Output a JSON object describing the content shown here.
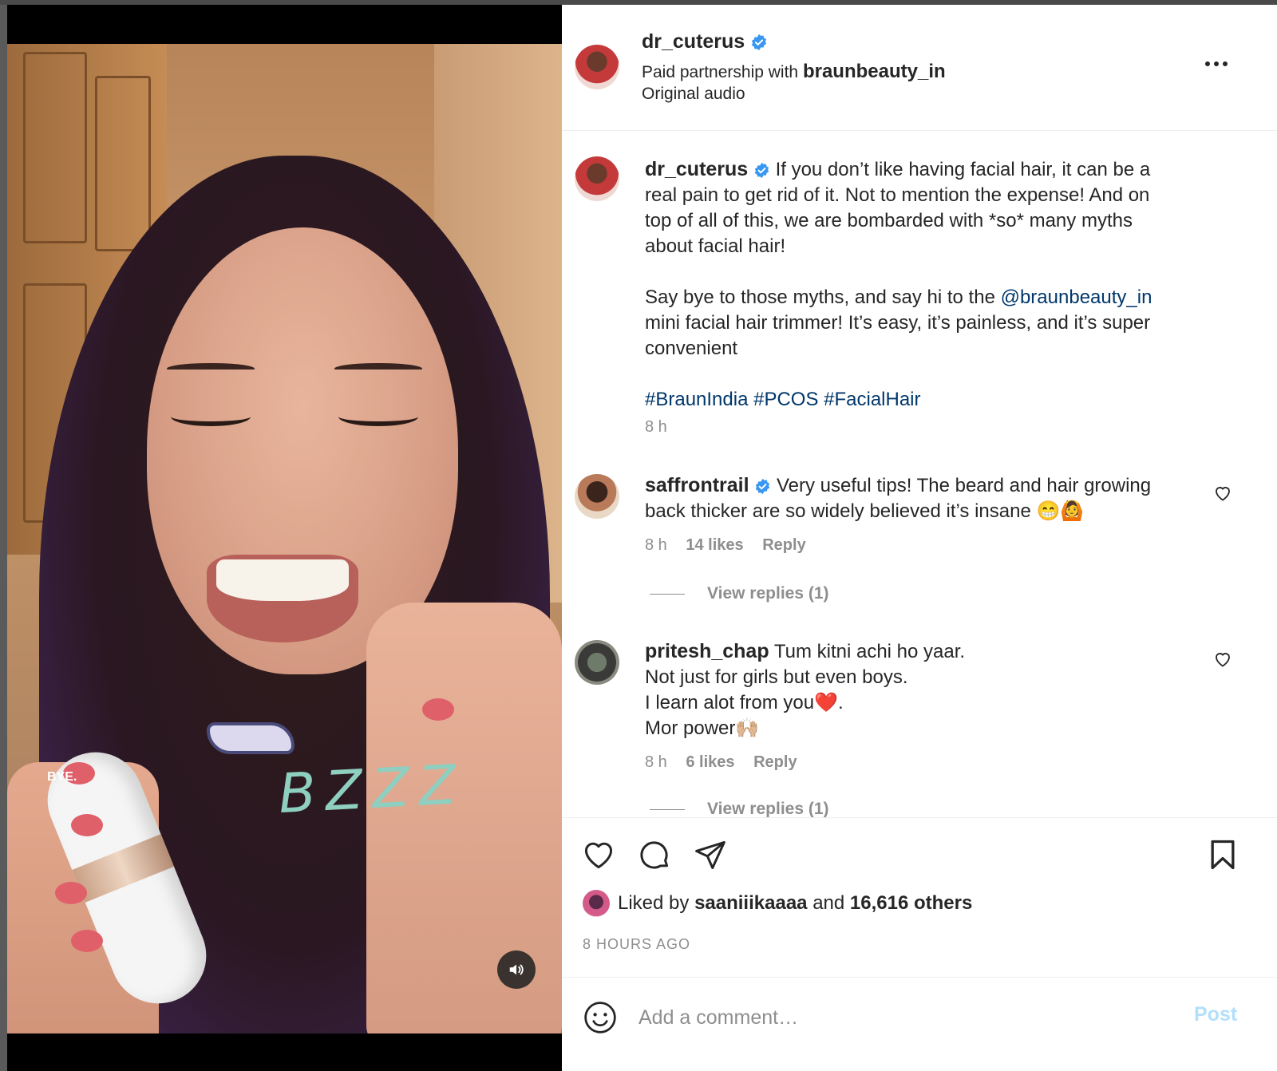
{
  "media": {
    "sticker_text": "BZZZ",
    "overlay_text": "BYE."
  },
  "header": {
    "username": "dr_cuterus",
    "partnership_prefix": "Paid partnership with",
    "partner": "braunbeauty_in",
    "audio": "Original audio"
  },
  "caption": {
    "username": "dr_cuterus",
    "line1": "If you don’t like having facial hair, it can be a",
    "line2": "real pain to get rid of it. Not to mention the expense! And on",
    "line3": "top of all of this, we are bombarded with *so* many myths",
    "line4": "about facial hair!",
    "p2_line1_prefix": "Say bye to those myths, and say hi to the",
    "p2_mention": "@braunbeauty_in",
    "p2_line2": "mini facial hair trimmer! It’s easy, it’s painless, and it’s super",
    "p2_line3": "convenient",
    "hashtags": "#BraunIndia #PCOS #FacialHair",
    "time": "8 h"
  },
  "comments": [
    {
      "username": "saffrontrail",
      "line1": "Very useful tips! The beard and hair growing",
      "line2": "back thicker are so widely believed it’s insane 😁🙆",
      "time": "8 h",
      "likes": "14 likes",
      "reply": "Reply",
      "view_replies": "View replies (1)"
    },
    {
      "username": "pritesh_chap",
      "line1": "Tum kitni achi ho yaar.",
      "line2": "Not just for girls but even boys.",
      "line3": "I learn alot from you❤️.",
      "line4": "Mor power🙌🏼",
      "time": "8 h",
      "likes": "6 likes",
      "reply": "Reply",
      "view_replies": "View replies (1)"
    }
  ],
  "actions": {
    "liked_by_prefix": "Liked by",
    "liked_by_user": "saaniiikaaaa",
    "and": "and",
    "others": "16,616 others",
    "time_ago": "8 HOURS AGO"
  },
  "add_comment": {
    "placeholder": "Add a comment…",
    "post_label": "Post"
  },
  "colors": {
    "link": "#00376b",
    "verified": "#3897f0",
    "post_disabled": "#b2dffc",
    "muted": "#8e8e8e"
  }
}
